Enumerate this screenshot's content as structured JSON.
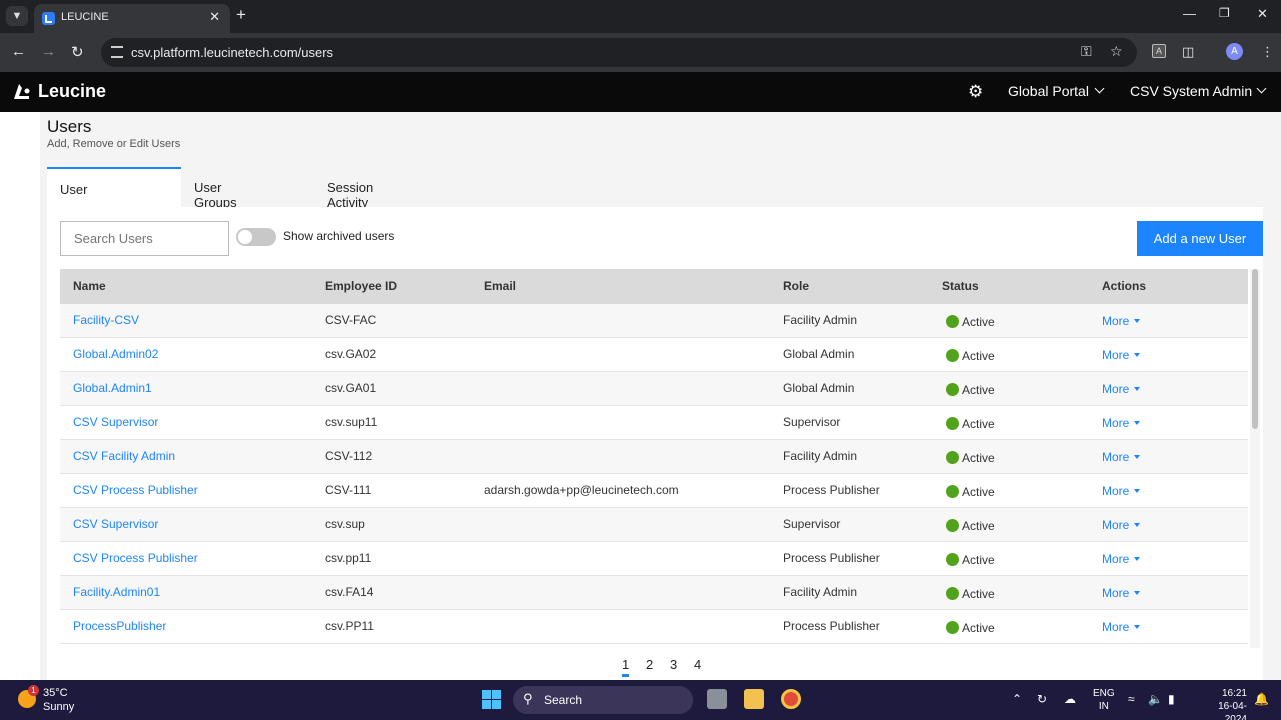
{
  "browser": {
    "tab_title": "LEUCINE",
    "url": "csv.platform.leucinetech.com/users",
    "profile_initial": "A",
    "ext_label": "A",
    "icons": [
      "tab-list-icon",
      "close-icon",
      "new-tab-icon",
      "minimize-icon",
      "restore-icon",
      "window-close-icon",
      "back-icon",
      "forward-icon",
      "reload-icon",
      "site-info-icon",
      "password-key-icon",
      "bookmark-star-icon",
      "extensions-icon",
      "menu-icon"
    ]
  },
  "header": {
    "brand": "Leucine",
    "portal_label": "Global Portal",
    "user_label": "CSV System Admin"
  },
  "page": {
    "title": "Users",
    "subtitle": "Add, Remove or Edit Users",
    "tabs": [
      "User",
      "User Groups",
      "Session Activity"
    ],
    "active_tab": "User"
  },
  "toolbar": {
    "search_placeholder": "Search Users",
    "archived_toggle_label": "Show archived users",
    "archived_toggle_on": false,
    "add_button": "Add a new User"
  },
  "table": {
    "columns": [
      "Name",
      "Employee ID",
      "Email",
      "Role",
      "Status",
      "Actions"
    ],
    "rows": [
      {
        "name": "Facility-CSV",
        "employee_id": "CSV-FAC",
        "email": "",
        "role": "Facility Admin",
        "status": "Active",
        "action": "More"
      },
      {
        "name": "Global.Admin02",
        "employee_id": "csv.GA02",
        "email": "",
        "role": "Global Admin",
        "status": "Active",
        "action": "More"
      },
      {
        "name": "Global.Admin1",
        "employee_id": "csv.GA01",
        "email": "",
        "role": "Global Admin",
        "status": "Active",
        "action": "More"
      },
      {
        "name": "CSV Supervisor",
        "employee_id": "csv.sup11",
        "email": "",
        "role": "Supervisor",
        "status": "Active",
        "action": "More"
      },
      {
        "name": "CSV Facility Admin",
        "employee_id": "CSV-112",
        "email": "",
        "role": "Facility Admin",
        "status": "Active",
        "action": "More"
      },
      {
        "name": "CSV Process Publisher",
        "employee_id": "CSV-111",
        "email": "adarsh.gowda+pp@leucinetech.com",
        "role": "Process Publisher",
        "status": "Active",
        "action": "More"
      },
      {
        "name": "CSV Supervisor",
        "employee_id": "csv.sup",
        "email": "",
        "role": "Supervisor",
        "status": "Active",
        "action": "More"
      },
      {
        "name": "CSV Process Publisher",
        "employee_id": "csv.pp11",
        "email": "",
        "role": "Process Publisher",
        "status": "Active",
        "action": "More"
      },
      {
        "name": "Facility.Admin01",
        "employee_id": "csv.FA14",
        "email": "",
        "role": "Facility Admin",
        "status": "Active",
        "action": "More"
      },
      {
        "name": "ProcessPublisher",
        "employee_id": "csv.PP11",
        "email": "",
        "role": "Process Publisher",
        "status": "Active",
        "action": "More"
      }
    ],
    "status_color": "#52a31c",
    "link_color": "#1d84ff"
  },
  "pagination": {
    "pages": [
      "1",
      "2",
      "3",
      "4"
    ],
    "current": "1"
  },
  "taskbar": {
    "temperature": "35°C",
    "condition": "Sunny",
    "weather_badge": "1",
    "search_label": "Search",
    "language_line1": "ENG",
    "language_line2": "IN",
    "time": "16:21",
    "date": "16-04-2024"
  }
}
